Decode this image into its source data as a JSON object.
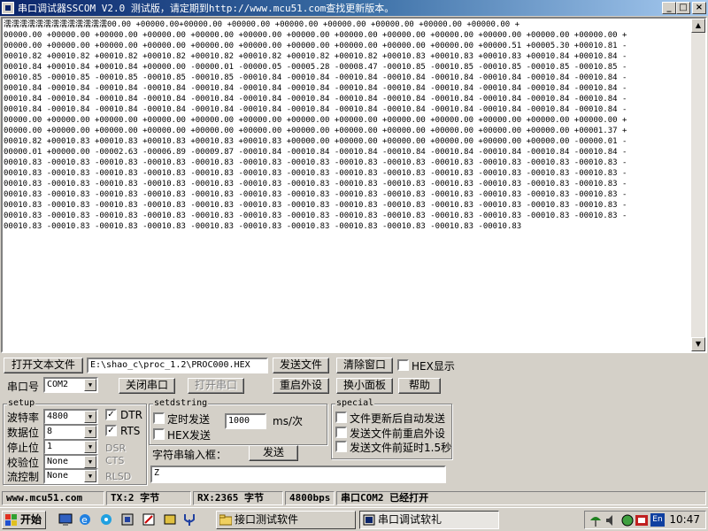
{
  "window": {
    "title": "串口调试器SSCOM V2.0  测试版，请定期到http://www.mcu51.com查找更新版本。",
    "btn_min": "_",
    "btn_max": "□",
    "btn_close": "×"
  },
  "output": {
    "lines": [
      "濡濡濡濡濡濡濡濡濡濡濡濡濡00.00 +00000.00+00000.00 +00000.00 +00000.00 +00000.00 +00000.00 +00000.00 +00000.00 +",
      "00000.00 +00000.00 +00000.00 +00000.00 +00000.00 +00000.00 +00000.00 +00000.00 +00000.00 +00000.00 +00000.00 +00000.00 +00000.00 +",
      "00000.00 +00000.00 +00000.00 +00000.00 +00000.00 +00000.00 +00000.00 +00000.00 +00000.00 +00000.00 +00000.51 +00005.30 +00010.81 -",
      "00010.82 +00010.82 +00010.82 +00010.82 +00010.82 +00010.82 +00010.82 +00010.82 +00010.83 +00010.83 +00010.83 +00010.84 +00010.84 -",
      "00010.84 +00010.84 +00010.84 +00000.00 -00000.01 -00000.05 -00005.28 -00008.47 -00010.85 -00010.85 -00010.85 -00010.85 -00010.85 -",
      "00010.85 -00010.85 -00010.85 -00010.85 -00010.85 -00010.84 -00010.84 -00010.84 -00010.84 -00010.84 -00010.84 -00010.84 -00010.84 -",
      "00010.84 -00010.84 -00010.84 -00010.84 -00010.84 -00010.84 -00010.84 -00010.84 -00010.84 -00010.84 -00010.84 -00010.84 -00010.84 -",
      "00010.84 -00010.84 -00010.84 -00010.84 -00010.84 -00010.84 -00010.84 -00010.84 -00010.84 -00010.84 -00010.84 -00010.84 -00010.84 -",
      "00010.84 -00010.84 -00010.84 -00010.84 -00010.84 -00010.84 -00010.84 -00010.84 -00010.84 -00010.84 -00010.84 -00010.84 -00010.84 -",
      "00000.00 +00000.00 +00000.00 +00000.00 +00000.00 +00000.00 +00000.00 +00000.00 +00000.00 +00000.00 +00000.00 +00000.00 +00000.00 +",
      "00000.00 +00000.00 +00000.00 +00000.00 +00000.00 +00000.00 +00000.00 +00000.00 +00000.00 +00000.00 +00000.00 +00000.00 +00001.37 +",
      "00010.82 +00010.83 +00010.83 +00010.83 +00010.83 +00010.83 +00000.00 +00000.00 +00000.00 +00000.00 +00000.00 +00000.00 -00000.01 -",
      "00000.01 +00000.00 -00002.63 -00006.89 -00009.87 -00010.84 -00010.84 -00010.84 -00010.84 -00010.84 -00010.84 -00010.84 -00010.84 -",
      "00010.83 -00010.83 -00010.83 -00010.83 -00010.83 -00010.83 -00010.83 -00010.83 -00010.83 -00010.83 -00010.83 -00010.83 -00010.83 -",
      "00010.83 -00010.83 -00010.83 -00010.83 -00010.83 -00010.83 -00010.83 -00010.83 -00010.83 -00010.83 -00010.83 -00010.83 -00010.83 -",
      "00010.83 -00010.83 -00010.83 -00010.83 -00010.83 -00010.83 -00010.83 -00010.83 -00010.83 -00010.83 -00010.83 -00010.83 -00010.83 -",
      "00010.83 -00010.83 -00010.83 -00010.83 -00010.83 -00010.83 -00010.83 -00010.83 -00010.83 -00010.83 -00010.83 -00010.83 -00010.83 -",
      "00010.83 -00010.83 -00010.83 -00010.83 -00010.83 -00010.83 -00010.83 -00010.83 -00010.83 -00010.83 -00010.83 -00010.83 -00010.83 -",
      "00010.83 -00010.83 -00010.83 -00010.83 -00010.83 -00010.83 -00010.83 -00010.83 -00010.83 -00010.83 -00010.83 -00010.83 -00010.83 -",
      "00010.83 -00010.83 -00010.83 -00010.83 -00010.83 -00010.83 -00010.83 -00010.83 -00010.83 -00010.83 -00010.83"
    ]
  },
  "controls": {
    "open_file": "打开文本文件",
    "file_path": "E:\\shao_c\\proc_1.2\\PROC000.HEX",
    "send_file": "发送文件",
    "clear_window": "清除窗口",
    "hex_display": "HEX显示",
    "port_label": "串口号",
    "port_value": "COM2",
    "close_port": "关闭串口",
    "open_port": "打开串口",
    "restart_device": "重启外设",
    "swap_panel": "换小面板",
    "help": "帮助"
  },
  "setup": {
    "title": "setup",
    "baud_label": "波特率",
    "baud_value": "4800",
    "databits_label": "数据位",
    "databits_value": "8",
    "stopbits_label": "停止位",
    "stopbits_value": "1",
    "parity_label": "校验位",
    "parity_value": "None",
    "flow_label": "流控制",
    "flow_value": "None",
    "dtr": "DTR",
    "rts": "RTS",
    "dsr": "DSR",
    "cts": "CTS",
    "rlsd": "RLSD"
  },
  "setdstring": {
    "title": "setdstring",
    "timed_send": "定时发送",
    "interval": "1000",
    "unit": "ms/次",
    "hex_send": "HEX发送",
    "input_label": "字符串输入框：",
    "send": "发送",
    "input_value": "Z"
  },
  "special": {
    "title": "special",
    "opt1": "文件更新后自动发送",
    "opt2": "发送文件前重启外设",
    "opt3": "发送文件前延时1.5秒"
  },
  "status": {
    "site": "www.mcu51.com",
    "tx": "TX:2 字节",
    "rx": "RX:2365 字节",
    "bps": "4800bps",
    "port_state": "串口COM2 已经打开"
  },
  "taskbar": {
    "start": "开始",
    "task1": "接口测试软件",
    "task2": "串口调试软礼",
    "tray_lang": "En",
    "clock": "10:47"
  }
}
